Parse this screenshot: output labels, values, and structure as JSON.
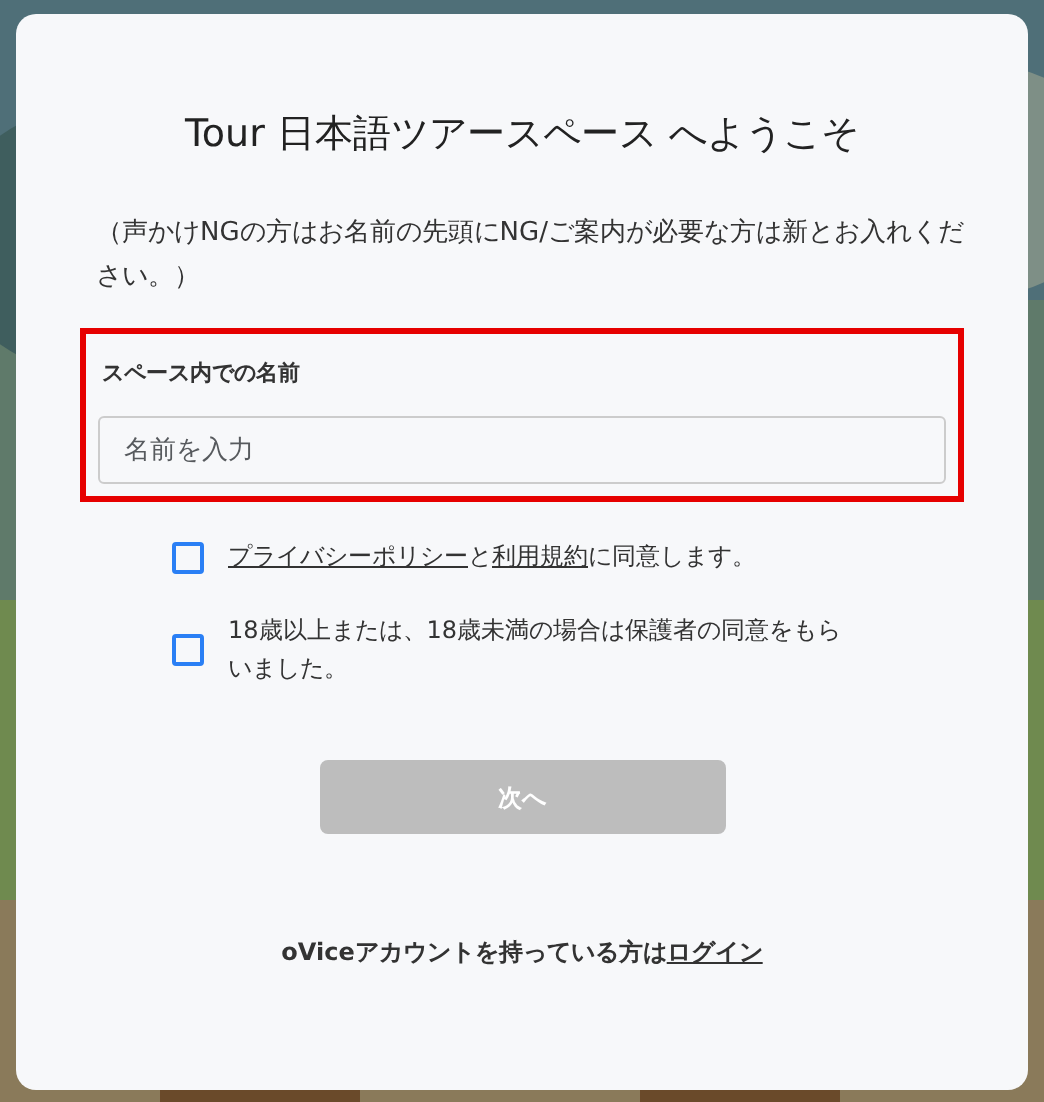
{
  "dialog": {
    "title": "Tour 日本語ツアースペース へようこそ",
    "note": "（声かけNGの方はお名前の先頭にNG/ご案内が必要な方は新とお入れください。）",
    "name_section": {
      "highlighted": true,
      "label": "スペース内での名前",
      "placeholder": "名前を入力"
    },
    "agreements": [
      {
        "checked": false,
        "parts": [
          {
            "kind": "link",
            "text": "プライバシーポリシー"
          },
          {
            "kind": "text",
            "text": "と"
          },
          {
            "kind": "link",
            "text": "利用規約"
          },
          {
            "kind": "text",
            "text": "に同意します。"
          }
        ]
      },
      {
        "checked": false,
        "parts": [
          {
            "kind": "text",
            "text": "18歳以上または、18歳未満の場合は保護者の同意をもらいました。"
          }
        ]
      }
    ],
    "next_button": {
      "label": "次へ",
      "disabled": true
    },
    "footer": {
      "parts": [
        {
          "kind": "text",
          "text": "oViceアカウントを持っている方は"
        },
        {
          "kind": "link",
          "text": "ログイン"
        }
      ]
    }
  }
}
